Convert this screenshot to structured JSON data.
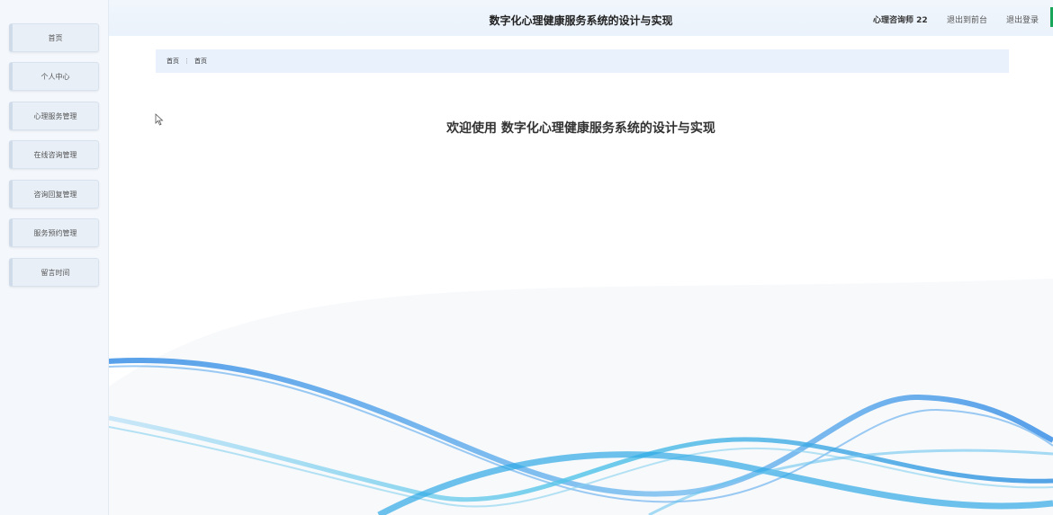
{
  "header": {
    "title": "数字化心理健康服务系统的设计与实现",
    "user_label": "心理咨询师 22",
    "front_link": "退出到前台",
    "logout_link": "退出登录"
  },
  "sidebar": {
    "items": [
      {
        "label": "首页"
      },
      {
        "label": "个人中心"
      },
      {
        "label": "心理服务管理"
      },
      {
        "label": "在线咨询管理"
      },
      {
        "label": "咨询回复管理"
      },
      {
        "label": "服务预约管理"
      },
      {
        "label": "留言时间"
      }
    ]
  },
  "breadcrumb": {
    "items": [
      "首页",
      "首页"
    ],
    "separator": "⋮"
  },
  "main": {
    "welcome": "欢迎使用 数字化心理健康服务系统的设计与实现"
  },
  "icons": {
    "cursor": "mouse-pointer-icon",
    "background": "blue-wave-decoration"
  },
  "colors": {
    "header_bg": "#eaf2fb",
    "breadcrumb_bg": "#e9f2fc",
    "wave_blue": "#3a8fe6",
    "wave_cyan": "#4fc3e8",
    "edge_green": "#1aa65a"
  }
}
